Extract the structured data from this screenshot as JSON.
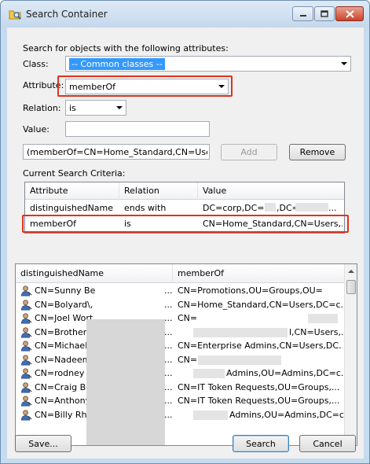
{
  "window": {
    "title": "Search Container"
  },
  "form": {
    "intro": "Search for objects with the following attributes:",
    "class_label": "Class:",
    "class_value": "-- Common classes --",
    "attribute_label": "Attribute:",
    "attribute_value": "memberOf",
    "relation_label": "Relation:",
    "relation_value": "is",
    "value_label": "Value:",
    "value_text": "",
    "criteria_text": "(memberOf=CN=Home_Standard,CN=Users,DC",
    "add_label": "Add",
    "remove_label": "Remove"
  },
  "criteria": {
    "label": "Current Search Criteria:",
    "columns": [
      "Attribute",
      "Relation",
      "Value"
    ],
    "rows": [
      {
        "attribute": "distinguishedName",
        "relation": "ends with",
        "value": "DC=corp,DC="
      },
      {
        "attribute": "memberOf",
        "relation": "is",
        "value": "CN=Home_Standard,CN=Users,..."
      }
    ]
  },
  "results": {
    "columns": [
      "distinguishedName",
      "memberOf"
    ],
    "rows": [
      {
        "dn": "CN=Sunny Be",
        "member": "CN=Promotions,OU=Groups,OU="
      },
      {
        "dn": "CN=Bolyard\\,",
        "member": "CN=Home_Standard,CN=Users,DC=c..."
      },
      {
        "dn": "CN=Joel Wort",
        "member": "CN="
      },
      {
        "dn": "CN=Brotherton",
        "member": "l,CN=Users,..."
      },
      {
        "dn": "CN=Michael E",
        "member": "CN=Enterprise Admins,CN=Users,DC..."
      },
      {
        "dn": "CN=Nadeem I",
        "member": "CN=I"
      },
      {
        "dn": "CN=rodney ph",
        "member": "Admins,OU=Admins,DC=c..."
      },
      {
        "dn": "CN=Craig Beu",
        "member": "CN=IT Token Requests,OU=Groups,..."
      },
      {
        "dn": "CN=Anthony T",
        "member": "CN=IT Token Requests,OU=Groups,..."
      },
      {
        "dn": "CN=Billy Rhea",
        "member": "Admins,OU=Admins,DC=c..."
      }
    ],
    "ellipsis": "..."
  },
  "footer": {
    "save_label": "Save...",
    "search_label": "Search",
    "cancel_label": "Cancel"
  },
  "colors": {
    "highlight_border": "#e0321c",
    "selection_blue": "#3399ff"
  },
  "icons": {
    "title": "search-container-icon",
    "row": "user-icon"
  }
}
